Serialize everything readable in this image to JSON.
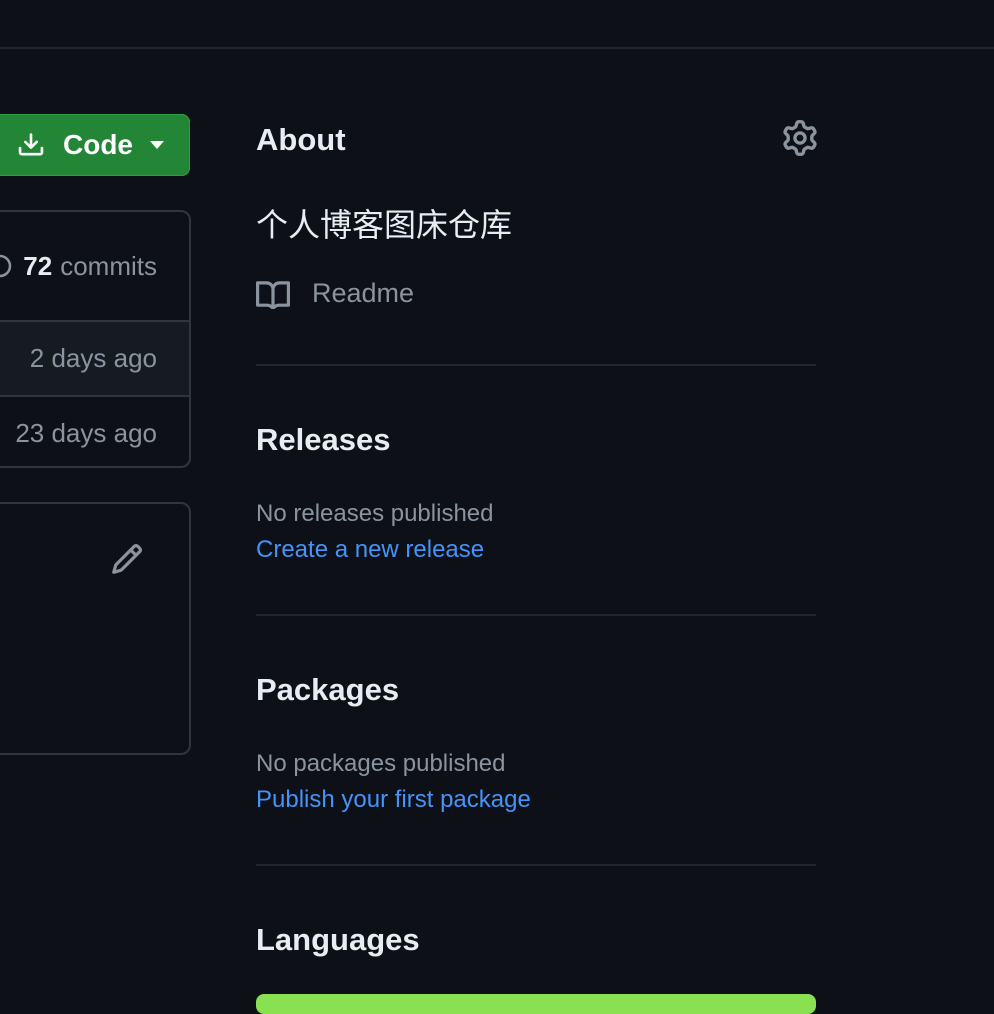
{
  "code_button": {
    "label": "Code",
    "icon": "download-icon",
    "color": "#238636"
  },
  "commits": {
    "count": "72",
    "label": "commits"
  },
  "file_rows": [
    {
      "time": "2 days ago"
    },
    {
      "time": "23 days ago"
    }
  ],
  "about": {
    "title": "About",
    "description": "个人博客图床仓库",
    "readme_label": "Readme"
  },
  "releases": {
    "title": "Releases",
    "empty_text": "No releases published",
    "create_link": "Create a new release"
  },
  "packages": {
    "title": "Packages",
    "empty_text": "No packages published",
    "publish_link": "Publish your first package"
  },
  "languages": {
    "title": "Languages",
    "bar_color": "#89e051",
    "bar_fraction": 1.0
  },
  "colors": {
    "background": "#0d1117",
    "link": "#4493f8",
    "muted": "#8b949e",
    "border": "#30363d"
  }
}
